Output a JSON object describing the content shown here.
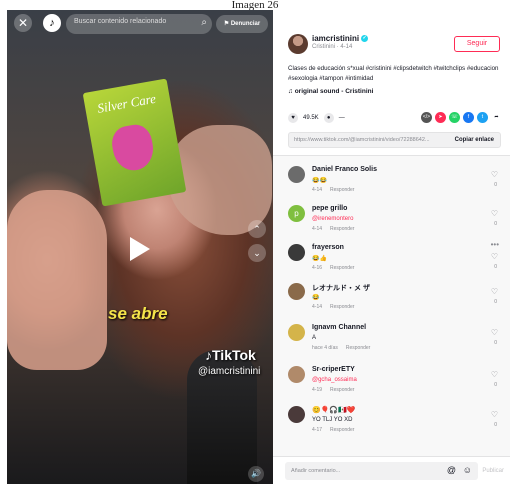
{
  "caption": "Imagen 26",
  "video": {
    "box_brand": "Silver Care",
    "subtitle": "se abre",
    "watermark_brand": "TikTok",
    "watermark_handle": "@iamcristinini",
    "search_placeholder": "Buscar contenido relacionado",
    "report_label": "Denunciar"
  },
  "post": {
    "username": "iamcristinini",
    "subline": "Cristinini · 4-14",
    "follow_label": "Seguir",
    "description": "Clases de educación s*xual #cristinini #clipsdetwitch #twitchclips #educacion #sexologia #tampon #intimidad",
    "sound": "original sound - Cristinini",
    "likes": "49.5K",
    "comments": "—",
    "link": "https://www.tiktok.com/@iamcristinini/video/72288642...",
    "copy_label": "Copiar enlace"
  },
  "comments": [
    {
      "name": "Daniel Franco Solis",
      "text": "😂😂",
      "meta": "4-14",
      "reply": "Responder",
      "likes": "0",
      "color": "#6b6b6b"
    },
    {
      "name": "pepe grillo",
      "text": "@irenemontero",
      "meta": "4-14",
      "reply": "Responder",
      "likes": "0",
      "color": "#7fbf3f",
      "initial": "p",
      "mention": true
    },
    {
      "name": "frayerson",
      "text": "😂👍",
      "meta": "4-16",
      "reply": "Responder",
      "likes": "0",
      "color": "#3a3a3a"
    },
    {
      "name": "レオナルド・メ ザ",
      "text": "😂",
      "meta": "4-14",
      "reply": "Responder",
      "likes": "0",
      "color": "#8a6a4a"
    },
    {
      "name": "Ignavm Channel",
      "text": "A",
      "meta": "hace 4 días",
      "reply": "Responder",
      "likes": "0",
      "color": "#d4b44a"
    },
    {
      "name": "Sr-criperETY",
      "text": "@gcha_ossaima",
      "meta": "4-19",
      "reply": "Responder",
      "likes": "0",
      "color": "#b08a6a",
      "mention": true
    },
    {
      "name": "😊🎈🎧🇲🇽❤️",
      "text": "YO TLJ YO XD",
      "meta": "4-17",
      "reply": "Responder",
      "likes": "0",
      "color": "#4a3a3a"
    }
  ],
  "footer": {
    "placeholder": "Añadir comentario...",
    "post_label": "Publicar"
  }
}
